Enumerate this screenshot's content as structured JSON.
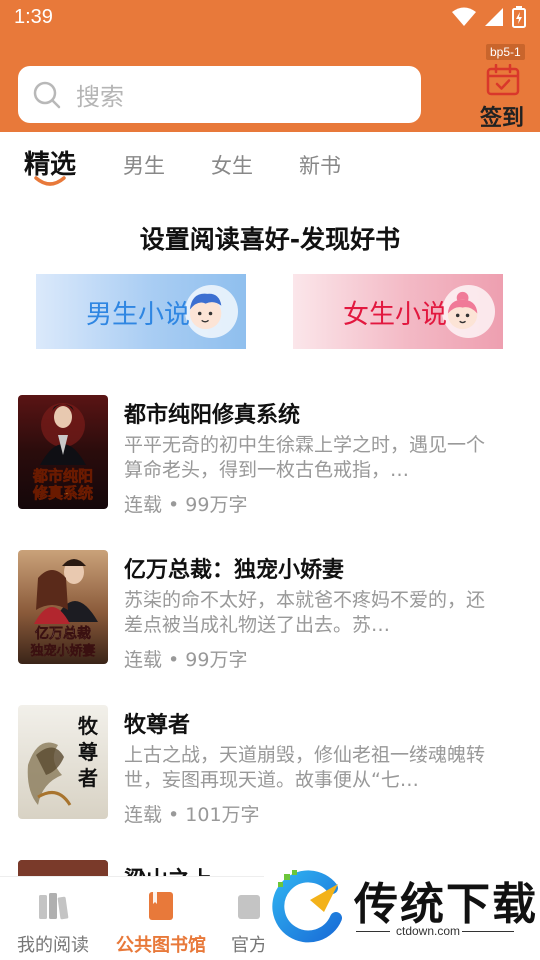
{
  "status_bar": {
    "time": "1:39"
  },
  "header": {
    "search_placeholder": "搜索",
    "badge": "bp5-1",
    "checkin_label": "签到",
    "accent_color": "#E8793A"
  },
  "tabs": [
    {
      "label": "精选",
      "active": true
    },
    {
      "label": "男生",
      "active": false
    },
    {
      "label": "女生",
      "active": false
    },
    {
      "label": "新书",
      "active": false
    }
  ],
  "preference": {
    "title": "设置阅读喜好-发现好书",
    "male_label": "男生小说",
    "female_label": "女生小说"
  },
  "books": [
    {
      "title": "都市纯阳修真系统",
      "description": "平平无奇的初中生徐霖上学之时，遇见一个算命老头，得到一枚古色戒指，…",
      "meta": "连载 • 99万字",
      "cover_text": "都市纯阳修真系统"
    },
    {
      "title": "亿万总裁：独宠小娇妻",
      "description": "苏柒的命不太好，本就爸不疼妈不爱的，还差点被当成礼物送了出去。苏…",
      "meta": "连载 • 99万字",
      "cover_text": "亿万总裁独宠小娇妻"
    },
    {
      "title": "牧尊者",
      "description": "上古之战，天道崩毁，修仙老祖一缕魂魄转世，妄图再现天道。故事便从“七…",
      "meta": "连载 • 101万字",
      "cover_text": "牧尊者"
    },
    {
      "title": "梁山之上",
      "description": "",
      "meta": "",
      "cover_text": ""
    }
  ],
  "bottom_nav": [
    {
      "label": "我的阅读",
      "active": false
    },
    {
      "label": "公共图书馆",
      "active": true
    },
    {
      "label": "官方",
      "active": false
    }
  ],
  "watermark": {
    "text": "传统下载",
    "url": "ctdown.com"
  }
}
